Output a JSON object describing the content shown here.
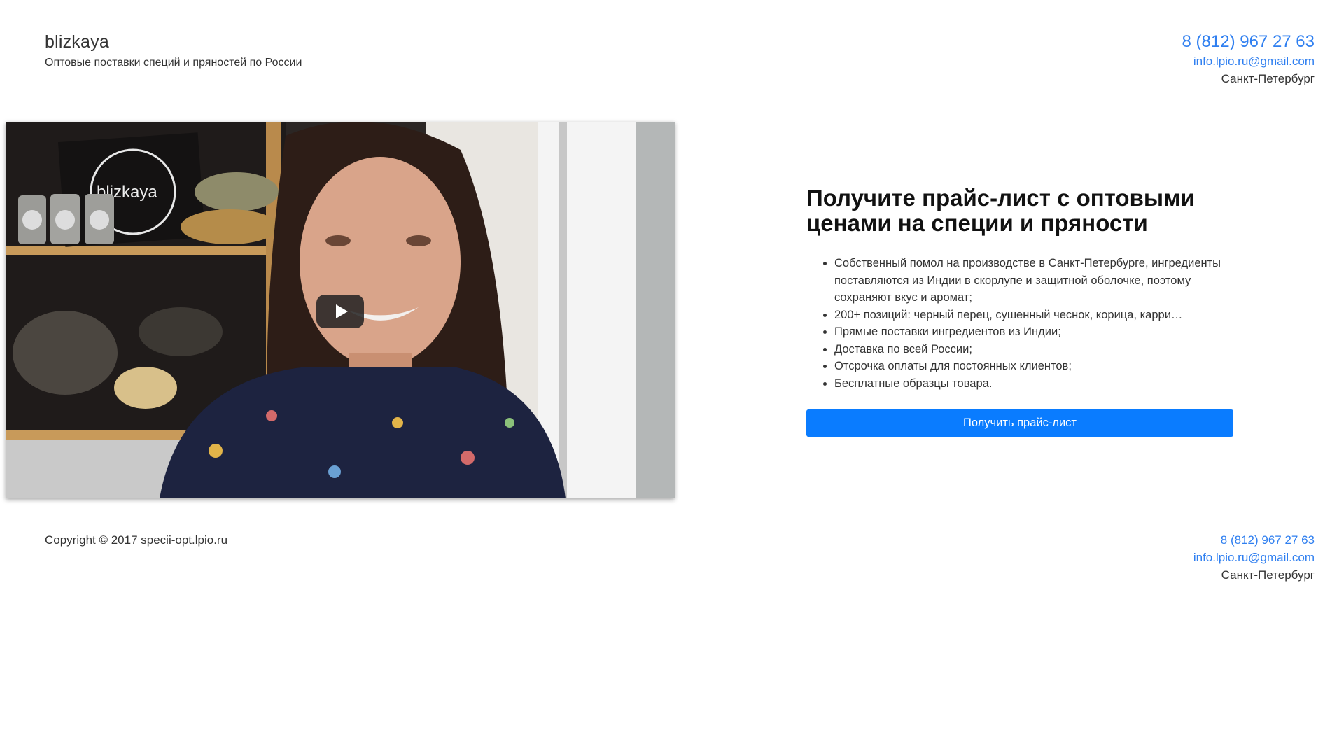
{
  "header": {
    "brand_name": "blizkaya",
    "tagline": "Оптовые поставки специй и пряностей по России",
    "phone": "8 (812) 967 27 63",
    "email": "info.lpio.ru@gmail.com",
    "city": "Санкт-Петербург"
  },
  "video": {
    "logo_text": "blizkaya",
    "play_icon": "play-icon"
  },
  "offer": {
    "title": "Получите прайс-лист с оптовыми ценами на специи и пряности",
    "benefits": [
      "Собственный помол на производстве в Санкт-Петербурге, ингредиенты поставляются из Индии в скорлупе и защитной оболочке, поэтому сохраняют вкус и аромат;",
      "200+ позиций: черный перец, сушенный чеснок, корица, карри…",
      "Прямые поставки ингредиентов из Индии;",
      "Доставка по всей России;",
      "Отсрочка оплаты для постоянных клиентов;",
      "Бесплатные образцы товара."
    ],
    "cta_label": "Получить прайс-лист"
  },
  "footer": {
    "copyright": "Copyright © 2017 specii-opt.lpio.ru",
    "phone": "8 (812) 967 27 63",
    "email": "info.lpio.ru@gmail.com",
    "city": "Санкт-Петербург"
  },
  "colors": {
    "accent": "#0a7cff",
    "link": "#2f7ff0",
    "text": "#333333",
    "heading": "#111111"
  }
}
